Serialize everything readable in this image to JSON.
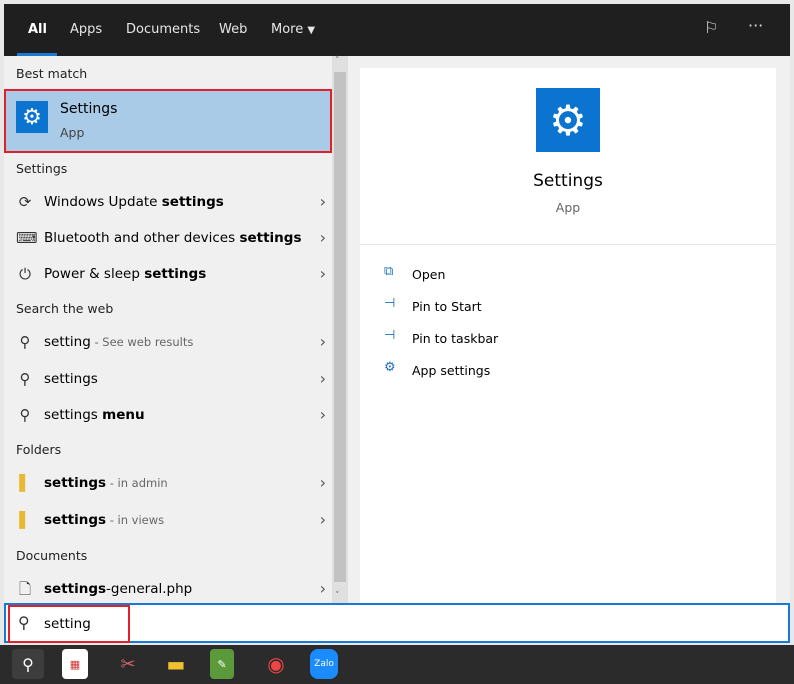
{
  "tabs": [
    {
      "label": "All",
      "active": true
    },
    {
      "label": "Apps"
    },
    {
      "label": "Documents"
    },
    {
      "label": "Web"
    },
    {
      "label": "More"
    }
  ],
  "header_icons": [
    "feedback-icon",
    "more-options-icon"
  ],
  "best_match": {
    "heading": "Best match",
    "title": "Settings",
    "subtitle": "App"
  },
  "settings_section": {
    "heading": "Settings",
    "items": [
      {
        "pre": "Windows Update ",
        "bold": "settings",
        "icon": "sync-icon"
      },
      {
        "pre": "Bluetooth and other devices ",
        "bold": "settings",
        "icon": "devices-icon"
      },
      {
        "pre": "Power & sleep ",
        "bold": "settings",
        "icon": "power-icon"
      }
    ]
  },
  "web_section": {
    "heading": "Search the web",
    "items": [
      {
        "pre": "setting",
        "bold": "",
        "suffix": " - See web results"
      },
      {
        "pre": "settings",
        "bold": "",
        "suffix": ""
      },
      {
        "pre": "settings ",
        "bold": "menu",
        "suffix": ""
      }
    ]
  },
  "folders_section": {
    "heading": "Folders",
    "items": [
      {
        "bold": "settings",
        "suffix": " - in admin"
      },
      {
        "bold": "settings",
        "suffix": " - in views"
      }
    ]
  },
  "documents_section": {
    "heading": "Documents",
    "items": [
      {
        "bold": "settings",
        "rest": "-general.php"
      }
    ]
  },
  "preview": {
    "title": "Settings",
    "subtitle": "App",
    "actions": [
      {
        "label": "Open",
        "icon": "open-icon"
      },
      {
        "label": "Pin to Start",
        "icon": "pin-icon"
      },
      {
        "label": "Pin to taskbar",
        "icon": "pin-icon"
      },
      {
        "label": "App settings",
        "icon": "gear-icon"
      }
    ]
  },
  "search": {
    "value": "setting"
  },
  "accent": "#0a74d0",
  "highlight": "#a9cbe8",
  "callout": "#e0202a"
}
